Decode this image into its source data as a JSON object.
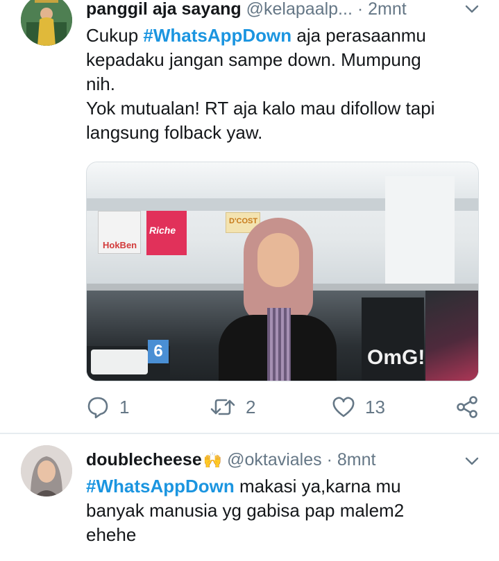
{
  "tweets": [
    {
      "name": "panggil aja sayang",
      "handle": "@kelapaalp...",
      "separator": "·",
      "time": "2mnt",
      "text_lines": [
        {
          "pre": "Cukup ",
          "hashtag": "#WhatsAppDown",
          "post": " aja perasaanmu"
        },
        {
          "pre": "kepadaku jangan sampe down. Mumpung",
          "hashtag": "",
          "post": ""
        },
        {
          "pre": "nih.",
          "hashtag": "",
          "post": ""
        },
        {
          "pre": "Yok mutualan! RT aja kalo mau difollow tapi",
          "hashtag": "",
          "post": ""
        },
        {
          "pre": "langsung folback yaw.",
          "hashtag": "",
          "post": ""
        }
      ],
      "photo": {
        "sign_hokben": "HokBen",
        "sign_richeese": "Riche",
        "sign_dcost": "D'COST",
        "gate_number": "6",
        "omg_text": "OmG!"
      },
      "actions": {
        "reply_count": "1",
        "retweet_count": "2",
        "like_count": "13"
      }
    },
    {
      "name": "doublecheese",
      "name_emoji": "🙌",
      "handle": "@oktaviales",
      "separator": "·",
      "time": "8mnt",
      "text_lines": [
        {
          "pre": "",
          "hashtag": "#WhatsAppDown",
          "post": " makasi ya,karna mu"
        },
        {
          "pre": "banyak manusia yg gabisa pap malem2",
          "hashtag": "",
          "post": ""
        },
        {
          "pre": "ehehe",
          "hashtag": "",
          "post": ""
        }
      ]
    }
  ],
  "colors": {
    "text": "#14171a",
    "secondary": "#657786",
    "hashtag": "#1b95e0",
    "divider": "#e6ecf0"
  },
  "icons": [
    "chevron-down-icon",
    "reply-icon",
    "retweet-icon",
    "like-icon",
    "share-icon"
  ]
}
